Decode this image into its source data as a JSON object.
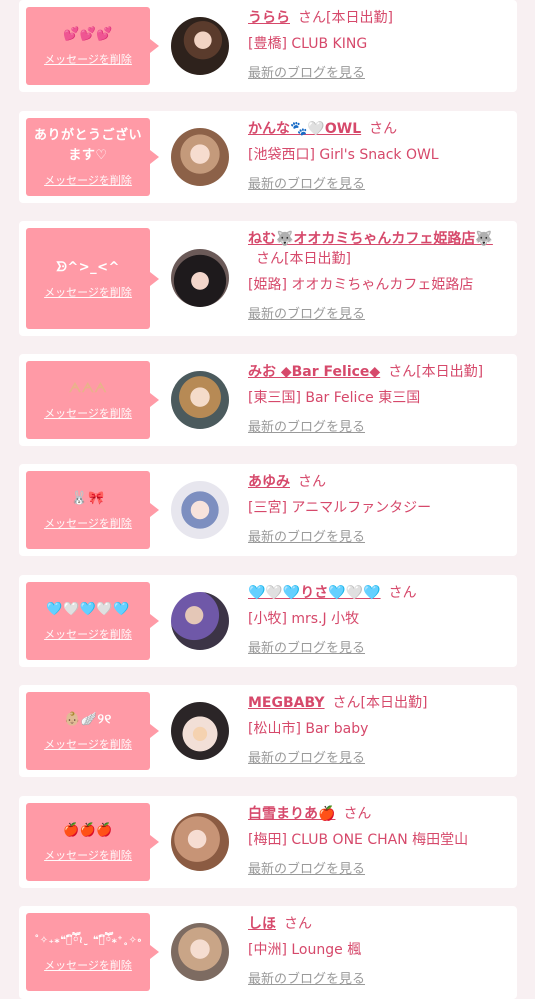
{
  "common": {
    "delete_label": "メッセージを削除",
    "blog_label": "最新のブログを見る"
  },
  "colors": {
    "accent": "#ff9aa6",
    "name_text": "#d6496b",
    "muted": "#9a9a9a",
    "page_bg": "#f8f0f2"
  },
  "items": [
    {
      "message": "💕💕💕",
      "name": "うらら",
      "suffix": "さん[本日出勤]",
      "shop": "[豊橋] CLUB KING"
    },
    {
      "message": "ありがとうございます♡",
      "name": "かんな🐾🤍OWL",
      "suffix": "さん",
      "shop": "[池袋西口] Girl's Snack OWL"
    },
    {
      "message": "ᗦ^>_<^",
      "name": "ねむ🐺オオカミちゃんカフェ姫路店🐺",
      "suffix": "さん[本日出勤]",
      "shop": "[姫路] オオカミちゃんカフェ姫路店"
    },
    {
      "message": "ᗅᗅᗅ",
      "name": "みお ◆Bar Felice◆",
      "suffix": "さん[本日出勤]",
      "shop": "[東三国] Bar Felice 東三国"
    },
    {
      "message": "🐰🎀",
      "name": "あゆみ",
      "suffix": "さん",
      "shop": "[三宮] アニマルファンタジー"
    },
    {
      "message": "🩵🤍🩵🤍🩵",
      "name": "🩵🤍🩵りさ🩵🤍🩵",
      "suffix": "さん",
      "shop": "[小牧] mrs.J 小牧"
    },
    {
      "message": "👶🏼🪽୨୧",
      "name": "MEGBABY",
      "suffix": "さん[本日出勤]",
      "shop": "[松山市] Bar baby"
    },
    {
      "message": "🍎🍎🍎",
      "name": "白雪まりあ🍎",
      "suffix": "さん",
      "shop": "[梅田] CLUB ONE CHAN 梅田堂山"
    },
    {
      "message": "˚✧₊⁎❝᷀ົཽ≀ˍ̮ ❝᷀ົཽ⁎⁺˳✧༚",
      "name": "しほ",
      "suffix": "さん",
      "shop": "[中洲] Lounge 楓"
    }
  ]
}
